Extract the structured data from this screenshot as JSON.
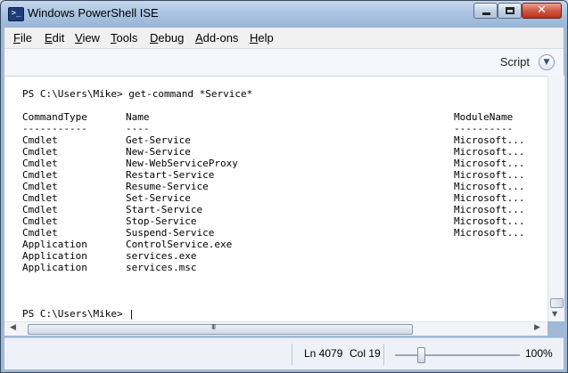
{
  "window": {
    "title": "Windows PowerShell ISE",
    "icon": "powershell-icon",
    "controls": {
      "minimize": "minimize-icon",
      "maximize": "maximize-icon",
      "close": "✕"
    }
  },
  "menu": [
    {
      "label": "File",
      "key": "F",
      "rest": "ile"
    },
    {
      "label": "Edit",
      "key": "E",
      "rest": "dit"
    },
    {
      "label": "View",
      "key": "V",
      "rest": "iew"
    },
    {
      "label": "Tools",
      "key": "T",
      "rest": "ools"
    },
    {
      "label": "Debug",
      "key": "D",
      "rest": "ebug"
    },
    {
      "label": "Add-ons",
      "key": "A",
      "rest": "dd-ons"
    },
    {
      "label": "Help",
      "key": "H",
      "rest": "elp"
    }
  ],
  "script_pane": {
    "label": "Script",
    "toggle_icon": "chevron-down-icon"
  },
  "console": {
    "command_line": "PS C:\\Users\\Mike> get-command *Service*",
    "headers": [
      "CommandType",
      "Name",
      "ModuleName"
    ],
    "underlines": [
      "-----------",
      "----",
      "----------"
    ],
    "rows": [
      [
        "Cmdlet",
        "Get-Service",
        "Microsoft..."
      ],
      [
        "Cmdlet",
        "New-Service",
        "Microsoft..."
      ],
      [
        "Cmdlet",
        "New-WebServiceProxy",
        "Microsoft..."
      ],
      [
        "Cmdlet",
        "Restart-Service",
        "Microsoft..."
      ],
      [
        "Cmdlet",
        "Resume-Service",
        "Microsoft..."
      ],
      [
        "Cmdlet",
        "Set-Service",
        "Microsoft..."
      ],
      [
        "Cmdlet",
        "Start-Service",
        "Microsoft..."
      ],
      [
        "Cmdlet",
        "Stop-Service",
        "Microsoft..."
      ],
      [
        "Cmdlet",
        "Suspend-Service",
        "Microsoft..."
      ],
      [
        "Application",
        "ControlService.exe",
        ""
      ],
      [
        "Application",
        "services.exe",
        ""
      ],
      [
        "Application",
        "services.msc",
        ""
      ]
    ],
    "prompt": "PS C:\\Users\\Mike> |"
  },
  "scrollbars": {
    "horizontal_grip": "III",
    "left_arrow": "◀",
    "right_arrow": "▶",
    "down_arrow": "▼"
  },
  "status": {
    "line": "Ln 4079",
    "col": "Col 19",
    "zoom": "100%"
  }
}
